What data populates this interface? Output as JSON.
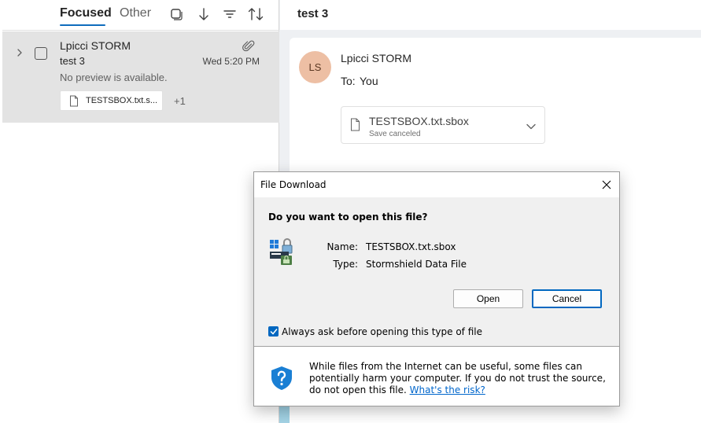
{
  "tabs": {
    "focused": "Focused",
    "other": "Other"
  },
  "toolbar_icons": [
    "select-mode-icon",
    "sort-direction-icon",
    "filter-icon",
    "sort-icon"
  ],
  "message_item": {
    "sender": "Lpicci STORM",
    "subject": "test 3",
    "time": "Wed 5:20 PM",
    "preview": "No preview is available.",
    "attachment_name": "TESTSBOX.txt.s...",
    "more_attachments": "+1"
  },
  "reading": {
    "title": "test 3",
    "avatar_initials": "LS",
    "sender": "Lpicci STORM",
    "to_label": "To:",
    "to_value": "You",
    "attachment_name": "TESTSBOX.txt.sbox",
    "attachment_status": "Save canceled"
  },
  "dialog": {
    "title": "File Download",
    "question": "Do you want to open this file?",
    "name_label": "Name:",
    "name_value": "TESTSBOX.txt.sbox",
    "type_label": "Type:",
    "type_value": "Stormshield Data File",
    "open_button": "Open",
    "cancel_button": "Cancel",
    "always_ask_label": "Always ask before opening this type of file",
    "always_ask_checked": true,
    "warning_text": "While files from the Internet can be useful, some files can potentially harm your computer. If you do not trust the source, do not open this file.",
    "risk_link": "What's the risk?"
  },
  "colors": {
    "accent": "#0f6cbd",
    "avatar_bg": "#edbfa4",
    "selected_item": "#e3e3e3",
    "dialog_bg": "#f0f0f0",
    "link": "#0066cc"
  }
}
